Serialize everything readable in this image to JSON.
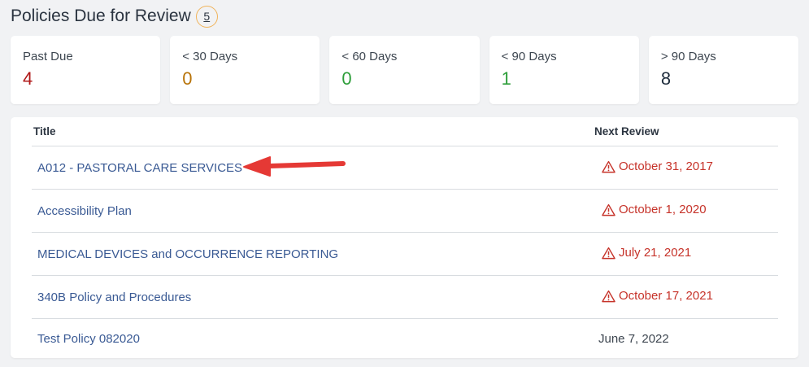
{
  "header": {
    "title": "Policies Due for Review",
    "count": "5"
  },
  "colors": {
    "past_due": "#b01818",
    "lt30": "#b8740a",
    "lt60": "#2e9e3a",
    "lt90": "#2e9e3a",
    "gt90": "#1f2d3d",
    "overdue_date": "#c6332a",
    "badge_border": "#f0b35a",
    "arrow": "#e53935"
  },
  "cards": [
    {
      "label": "Past Due",
      "value": "4"
    },
    {
      "label": "< 30 Days",
      "value": "0"
    },
    {
      "label": "< 60 Days",
      "value": "0"
    },
    {
      "label": "< 90 Days",
      "value": "1"
    },
    {
      "label": "> 90 Days",
      "value": "8"
    }
  ],
  "table": {
    "columns": {
      "title": "Title",
      "next_review": "Next Review"
    },
    "rows": [
      {
        "title": "A012 - PASTORAL CARE SERVICES",
        "next_review": "October 31, 2017",
        "overdue": true
      },
      {
        "title": "Accessibility Plan",
        "next_review": "October 1, 2020",
        "overdue": true
      },
      {
        "title": "MEDICAL DEVICES and OCCURRENCE REPORTING",
        "next_review": "July 21, 2021",
        "overdue": true
      },
      {
        "title": "340B Policy and Procedures",
        "next_review": "October 17, 2021",
        "overdue": true
      },
      {
        "title": "Test Policy 082020",
        "next_review": "June 7, 2022",
        "overdue": false
      }
    ]
  },
  "annotation": {
    "icon": "red-arrow-pointing-left"
  }
}
